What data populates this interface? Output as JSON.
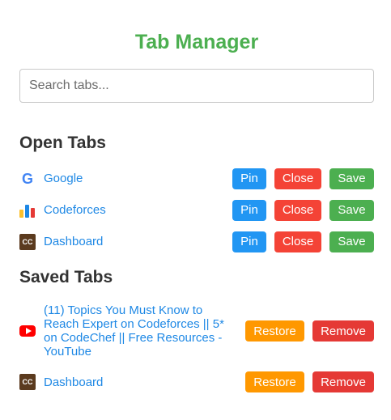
{
  "app": {
    "title": "Tab Manager"
  },
  "search": {
    "placeholder": "Search tabs..."
  },
  "open_tabs": {
    "heading": "Open Tabs",
    "items": [
      {
        "title": "Google",
        "icon": "google-icon",
        "pin_label": "Pin",
        "close_label": "Close",
        "save_label": "Save"
      },
      {
        "title": "Codeforces",
        "icon": "codeforces-icon",
        "pin_label": "Pin",
        "close_label": "Close",
        "save_label": "Save"
      },
      {
        "title": "Dashboard",
        "icon": "codechef-icon",
        "pin_label": "Pin",
        "close_label": "Close",
        "save_label": "Save"
      }
    ]
  },
  "saved_tabs": {
    "heading": "Saved Tabs",
    "items": [
      {
        "title": "(11) Topics You Must Know to Reach Expert on Codeforces || 5* on CodeChef || Free Resources - YouTube",
        "icon": "youtube-icon",
        "restore_label": "Restore",
        "remove_label": "Remove"
      },
      {
        "title": "Dashboard",
        "icon": "codechef-icon",
        "restore_label": "Restore",
        "remove_label": "Remove"
      }
    ]
  },
  "icon_text": {
    "google": "G",
    "codechef": "CC"
  },
  "colors": {
    "title": "#4caf50",
    "link": "#1e88e5",
    "pin": "#2196f3",
    "close": "#f44336",
    "save": "#4caf50",
    "restore": "#ff9800",
    "remove": "#e53935"
  }
}
